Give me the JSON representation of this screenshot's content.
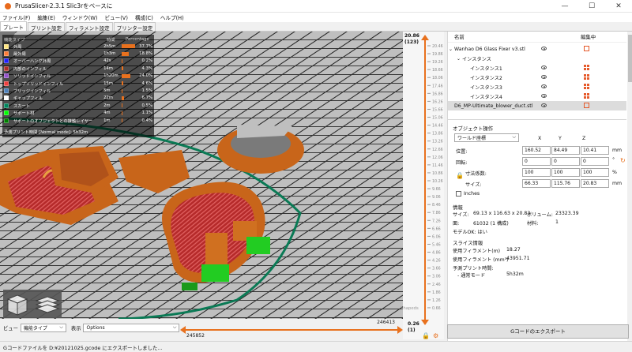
{
  "window": {
    "title": "PrusaSlicer-2.3.1 Slic3rをベースに",
    "minimize": "—",
    "maximize": "☐",
    "close": "✕"
  },
  "menu": [
    "ファイル(F)",
    "編集(E)",
    "ウィンドウ(W)",
    "ビュー(V)",
    "構成(C)",
    "ヘルプ(H)"
  ],
  "tabs": [
    "プレート",
    "プリント設定",
    "フィラメント設定",
    "プリンター設定"
  ],
  "legend": {
    "headers": {
      "type": "機能タイプ",
      "time": "時間",
      "pct": "Percentage"
    },
    "rows": [
      {
        "name": "外周",
        "time": "2h5m",
        "pct": "37.7%",
        "frac": 0.377,
        "color": "#ffe680"
      },
      {
        "name": "最外周",
        "time": "1h3m",
        "pct": "18.8%",
        "frac": 0.188,
        "color": "#ff7d38"
      },
      {
        "name": "オーバーハング外周",
        "time": "42s",
        "pct": "0.2%",
        "frac": 0.002,
        "color": "#1f1fff"
      },
      {
        "name": "内部のインフィル",
        "time": "14m",
        "pct": "4.3%",
        "frac": 0.043,
        "color": "#b03029"
      },
      {
        "name": "ソリッドインフィル",
        "time": "1h20m",
        "pct": "24.0%",
        "frac": 0.24,
        "color": "#9654cc"
      },
      {
        "name": "トップソリッドインフィル",
        "time": "15m",
        "pct": "4.6%",
        "frac": 0.046,
        "color": "#f04040"
      },
      {
        "name": "ブリッジインフィル",
        "time": "5m",
        "pct": "1.5%",
        "frac": 0.015,
        "color": "#4d80ba"
      },
      {
        "name": "ギャップフィル",
        "time": "22m",
        "pct": "6.7%",
        "frac": 0.067,
        "color": "#ffffff"
      },
      {
        "name": "スカート",
        "time": "2m",
        "pct": "0.5%",
        "frac": 0.005,
        "color": "#00875e"
      },
      {
        "name": "サポート材",
        "time": "4m",
        "pct": "1.1%",
        "frac": 0.011,
        "color": "#00ff00"
      },
      {
        "name": "サポートのオブジェクトとの接触レイヤー",
        "time": "1m",
        "pct": "0.4%",
        "frac": 0.004,
        "color": "#008000"
      }
    ],
    "total_label": "予測プリント時間 [Normal mode]:",
    "total_value": "5h32m"
  },
  "vslider": {
    "top_value": "20.86",
    "top_layer": "(123)",
    "bottom_value": "0.26",
    "bottom_layer": "(1)",
    "ticks": [
      "20.46",
      "19.86",
      "19.26",
      "18.66",
      "18.06",
      "17.46",
      "16.86",
      "16.26",
      "15.66",
      "15.06",
      "14.46",
      "13.86",
      "13.26",
      "12.66",
      "12.06",
      "11.46",
      "10.86",
      "10.26",
      "9.66",
      "9.06",
      "8.46",
      "7.86",
      "7.26",
      "6.66",
      "6.06",
      "5.46",
      "4.86",
      "4.26",
      "3.66",
      "3.06",
      "2.46",
      "1.86",
      "1.26",
      "0.66"
    ],
    "watermark": "Shapeds"
  },
  "hslider": {
    "left_value": "245852",
    "right_value": "246413"
  },
  "bottombar": {
    "view_label": "ビュー",
    "view_value": "機能タイプ",
    "show_label": "表示",
    "show_value": "Options"
  },
  "status": "Gコードファイルを D:¥20121025.gcode にエクスポートしました...",
  "objlist": {
    "headers": {
      "name": "名前",
      "editing": "編集中"
    },
    "rows": [
      {
        "label": "Wanhao D6 Glass Fixer v3.stl",
        "indent": 0,
        "arrow": "⌄",
        "eye": true,
        "icon": "edit"
      },
      {
        "label": "インスタンス",
        "indent": 1,
        "arrow": "⌄",
        "eye": false,
        "icon": ""
      },
      {
        "label": "インスタンス1",
        "indent": 2,
        "arrow": "",
        "eye": true,
        "icon": "grid"
      },
      {
        "label": "インスタンス2",
        "indent": 2,
        "arrow": "",
        "eye": true,
        "icon": "grid"
      },
      {
        "label": "インスタンス3",
        "indent": 2,
        "arrow": "",
        "eye": true,
        "icon": "grid"
      },
      {
        "label": "インスタンス4",
        "indent": 2,
        "arrow": "",
        "eye": true,
        "icon": "grid"
      },
      {
        "label": "D6_MP-Ultimate_blower_duct.stl",
        "indent": 0,
        "arrow": "",
        "eye": true,
        "icon": "edit"
      }
    ]
  },
  "manip": {
    "title": "オブジェクト操作",
    "coord": "ワールド座標",
    "x": "X",
    "y": "Y",
    "z": "Z",
    "position_label": "位置:",
    "position": [
      "160.52",
      "84.49",
      "10.41"
    ],
    "position_unit": "mm",
    "rotation_label": "回転:",
    "rotation": [
      "0",
      "0",
      "0"
    ],
    "rotation_unit": "°",
    "scale_label": "寸法係数:",
    "scale": [
      "100",
      "100",
      "100"
    ],
    "scale_unit": "%",
    "size_label": "サイズ:",
    "size": [
      "66.33",
      "115.76",
      "20.83"
    ],
    "size_unit": "mm",
    "inches": "Inches"
  },
  "info": {
    "title": "情報",
    "size_label": "サイズ:",
    "size_value": "69.13 x 116.63 x 20.83",
    "volume_label": "ボリューム:",
    "volume_value": "23323.39",
    "facets_label": "面:",
    "facets_value": "61032 (1 構成)",
    "materials_label": "材料:",
    "materials_value": "1",
    "manifold": "モデルOK: はい"
  },
  "slice": {
    "title": "スライス情報",
    "used_fil_m_label": "使用フィラメント(m)",
    "used_fil_m": "18.27",
    "used_fil_mm3_label": "使用フィラメント (mm³)",
    "used_fil_mm3": "43951.71",
    "est_label": "予測プリント時間:",
    "normal_label": "- 通常モード",
    "normal_value": "5h32m"
  },
  "export_button": "Gコードのエクスポート"
}
